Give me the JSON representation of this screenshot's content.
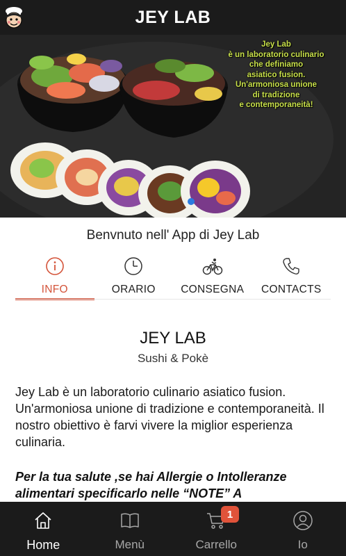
{
  "header": {
    "title": "JEY LAB",
    "logo_icon": "chef-mascot-logo"
  },
  "hero": {
    "image": "poke-bowls-and-sushi-burritos",
    "overlay_text": [
      "Jey Lab",
      "è un laboratorio culinario",
      "che definiamo",
      "asiatico fusion.",
      "Un'armoniosa unione",
      "di tradizione",
      "e contemporaneità!"
    ]
  },
  "welcome": "Benvnuto nell' App di Jey Lab",
  "tabs": [
    {
      "label": "INFO",
      "icon": "info-icon",
      "active": true
    },
    {
      "label": "ORARIO",
      "icon": "clock-icon",
      "active": false
    },
    {
      "label": "CONSEGNA",
      "icon": "bicycle-icon",
      "active": false
    },
    {
      "label": "CONTACTS",
      "icon": "phone-icon",
      "active": false
    }
  ],
  "content": {
    "title": "JEY LAB",
    "subtitle": "Sushi & Pokè",
    "description": "Jey Lab è un laboratorio culinario asiatico fusion. Un'armoniosa unione di tradizione e contemporaneità. Il nostro obiettivo è farvi vivere la miglior esperienza culinaria.",
    "allergy_note": "Per la tua salute ,se hai Allergie o Intolleranze alimentari specificarlo nelle “NOTE” A"
  },
  "bottom_nav": [
    {
      "label": "Home",
      "icon": "home-icon",
      "active": true
    },
    {
      "label": "Menù",
      "icon": "book-icon",
      "active": false
    },
    {
      "label": "Carrello",
      "icon": "cart-icon",
      "active": false,
      "badge": "1"
    },
    {
      "label": "Io",
      "icon": "user-icon",
      "active": false
    }
  ],
  "colors": {
    "header_bg": "#1b1b1b",
    "accent": "#d4543a",
    "badge": "#e0533a",
    "hero_text": "#c8e04a"
  }
}
